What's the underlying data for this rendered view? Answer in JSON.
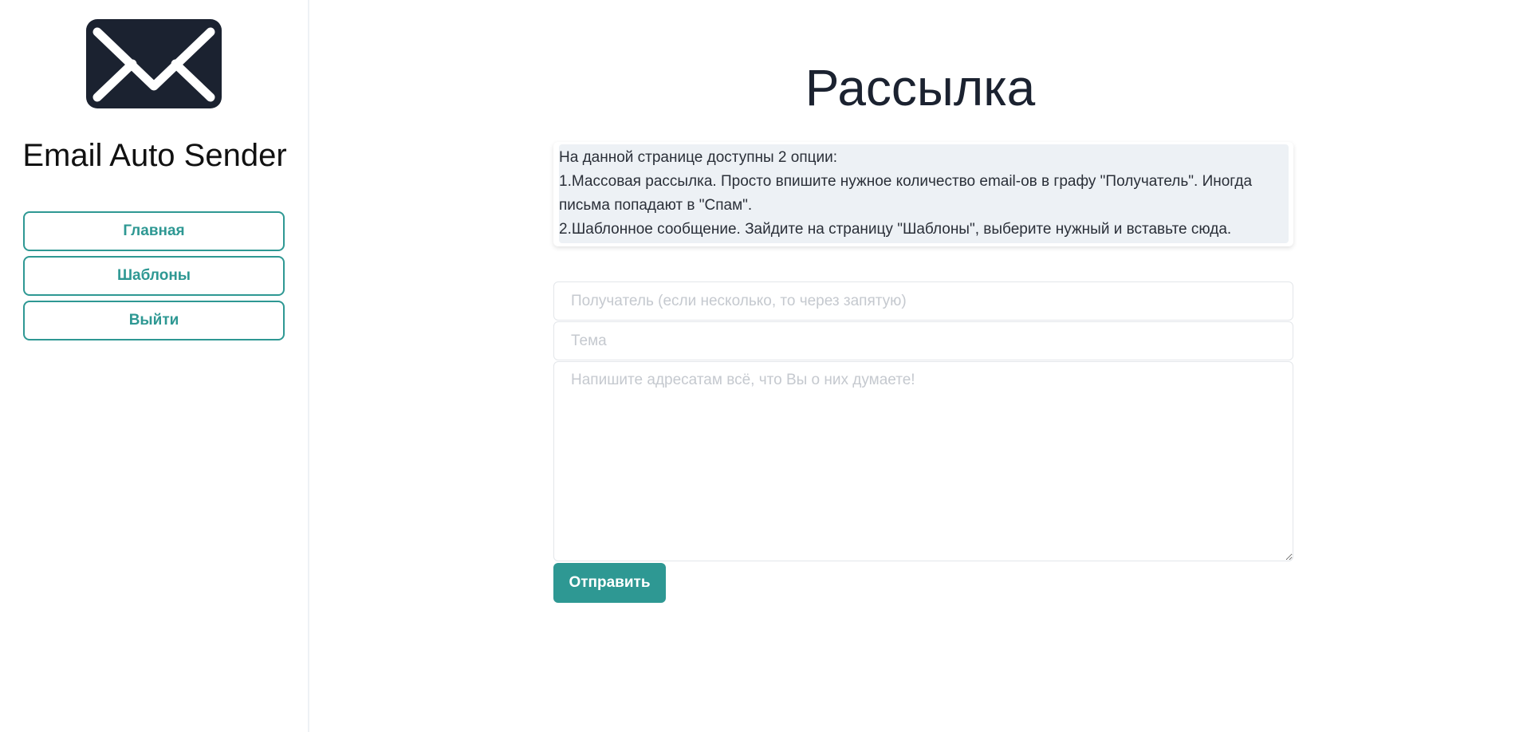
{
  "sidebar": {
    "logo_icon": "envelope-icon",
    "app_name": "Email Auto Sender",
    "nav": [
      {
        "label": "Главная"
      },
      {
        "label": "Шаблоны"
      },
      {
        "label": "Выйти"
      }
    ]
  },
  "main": {
    "title": "Рассылка",
    "info": [
      "На данной странице доступны 2 опции:",
      "1.Массовая рассылка. Просто впишите нужное количество email-ов в графу \"Получатель\". Иногда письма попадают в \"Спам\".",
      "2.Шаблонное сообщение. Зайдите на страницу \"Шаблоны\", выберите нужный и вставьте сюда."
    ],
    "form": {
      "recipient_placeholder": "Получатель (если несколько, то через запятую)",
      "subject_placeholder": "Тема",
      "body_placeholder": "Напишите адресатам всё, что Вы о них думаете!",
      "send_label": "Отправить"
    }
  },
  "colors": {
    "accent": "#2e9893",
    "text_dark": "#1b2230",
    "info_bg": "#edf1f5"
  }
}
